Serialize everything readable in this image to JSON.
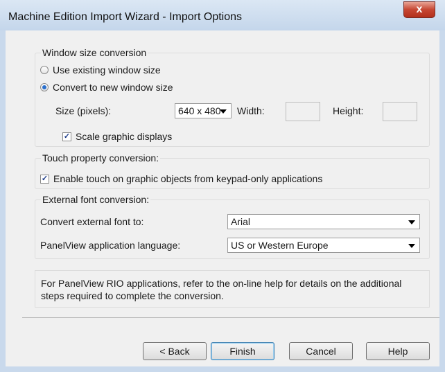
{
  "window": {
    "title": "Machine Edition Import Wizard - Import Options",
    "close_glyph": "x"
  },
  "window_size": {
    "label": "Window size conversion",
    "option_existing": "Use existing window size",
    "option_new": "Convert to new window size",
    "selected": "option_new",
    "size_label": "Size (pixels):",
    "size_value": "640 x 480",
    "width_label": "Width:",
    "width_value": "",
    "height_label": "Height:",
    "height_value": "",
    "scale_label": "Scale graphic displays",
    "scale_checked": true
  },
  "touch": {
    "label": "Touch property conversion:",
    "enable_label": "Enable touch on graphic objects from keypad-only applications",
    "enable_checked": true
  },
  "font": {
    "label": "External font conversion:",
    "convert_label": "Convert external font to:",
    "convert_value": "Arial",
    "language_label": "PanelView application language:",
    "language_value": "US or Western Europe"
  },
  "note": {
    "line1": "For PanelView RIO applications, refer to the on-line help for details on the additional",
    "line2": "steps required to complete the conversion."
  },
  "buttons": {
    "back": "< Back",
    "finish": "Finish",
    "cancel": "Cancel",
    "help": "Help"
  },
  "check_glyph": "✓"
}
